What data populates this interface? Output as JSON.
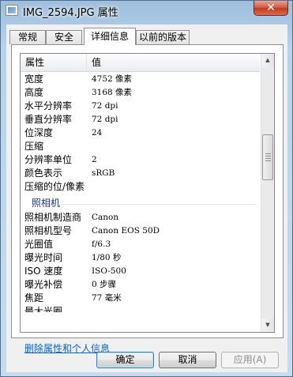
{
  "window": {
    "title": "IMG_2594.JPG 属性",
    "close_glyph": "✕"
  },
  "tabs": [
    {
      "label": "常规"
    },
    {
      "label": "安全"
    },
    {
      "label": "详细信息"
    },
    {
      "label": "以前的版本"
    }
  ],
  "list": {
    "columns": {
      "name": "属性",
      "value": "值"
    },
    "rows": [
      {
        "name": "宽度",
        "value": "4752 像素"
      },
      {
        "name": "高度",
        "value": "3168 像素"
      },
      {
        "name": "水平分辨率",
        "value": "72 dpi"
      },
      {
        "name": "垂直分辨率",
        "value": "72 dpi"
      },
      {
        "name": "位深度",
        "value": "24"
      },
      {
        "name": "压缩",
        "value": ""
      },
      {
        "name": "分辨率单位",
        "value": "2"
      },
      {
        "name": "颜色表示",
        "value": "sRGB"
      },
      {
        "name": "压缩的位/像素",
        "value": ""
      }
    ],
    "section_camera": "照相机",
    "camera_rows": [
      {
        "name": "照相机制造商",
        "value": "Canon"
      },
      {
        "name": "照相机型号",
        "value": "Canon EOS 50D"
      },
      {
        "name": "光圈值",
        "value": "f/6.3"
      },
      {
        "name": "曝光时间",
        "value": "1/80 秒"
      },
      {
        "name": "ISO 速度",
        "value": "ISO-500"
      },
      {
        "name": "曝光补偿",
        "value": "0 步骤"
      },
      {
        "name": "焦距",
        "value": "77 毫米"
      },
      {
        "name": "最大光圈",
        "value": ""
      }
    ]
  },
  "scrollbar": {
    "up_glyph": "▲",
    "down_glyph": "▼"
  },
  "remove_link": "删除属性和个人信息",
  "buttons": {
    "ok": "确定",
    "cancel": "取消",
    "apply": "应用(A)"
  },
  "colors": {
    "section_label": "#1e3287",
    "link": "#0066cc",
    "close_button": "#c03a22"
  }
}
